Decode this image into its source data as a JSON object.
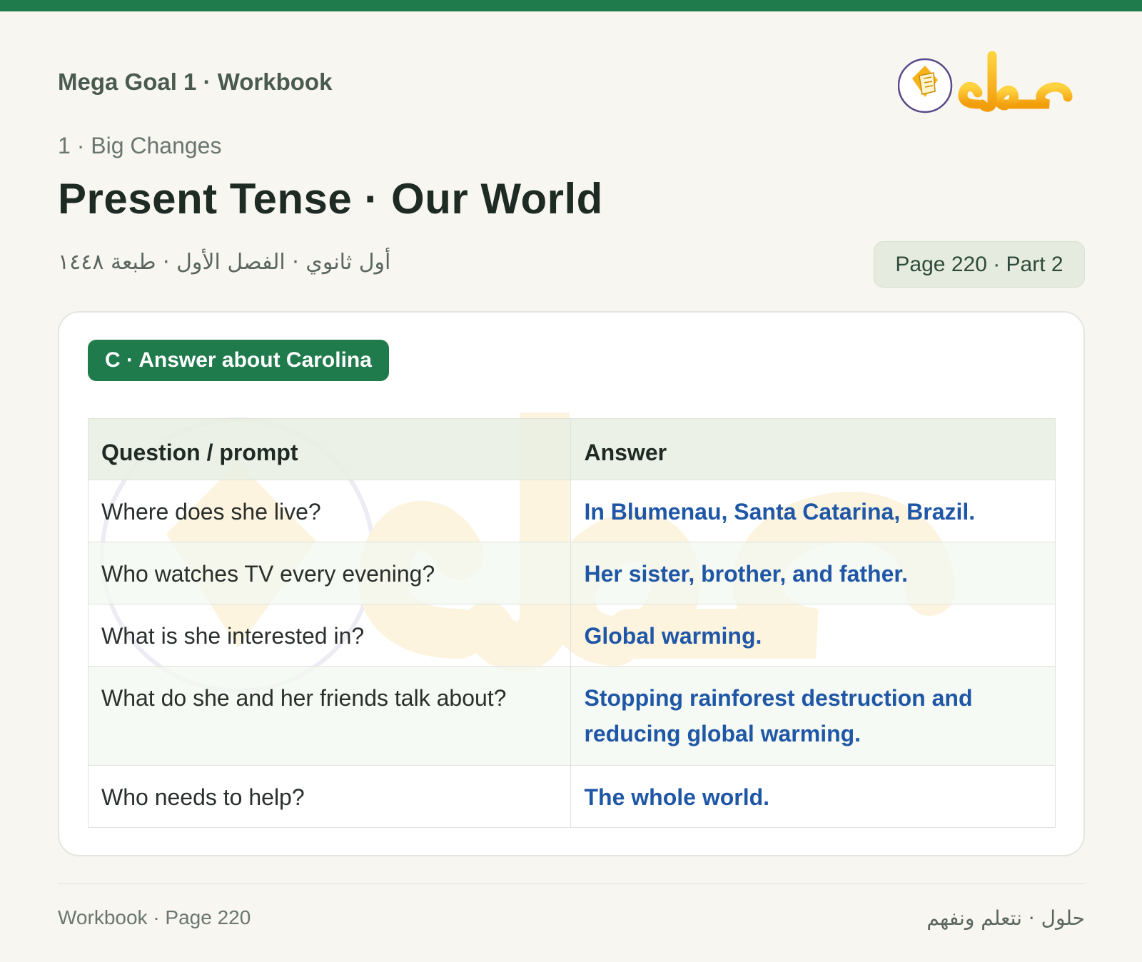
{
  "header": {
    "subtitle": "Mega Goal 1 · Workbook",
    "logo_text": "حلول",
    "unit": "1 · Big Changes",
    "title": "Present Tense · Our World",
    "arabic_meta": "أول ثانوي · الفصل الأول · طبعة ١٤٤٨",
    "page_badge": "Page 220 · Part 2"
  },
  "section": {
    "label": "C · Answer about Carolina"
  },
  "table": {
    "headers": [
      "Question / prompt",
      "Answer"
    ],
    "rows": [
      {
        "question": "Where does she live?",
        "answer": "In Blumenau, Santa Catarina, Brazil."
      },
      {
        "question": "Who watches TV every evening?",
        "answer": "Her sister, brother, and father."
      },
      {
        "question": "What is she interested in?",
        "answer": "Global warming."
      },
      {
        "question": "What do she and her friends talk about?",
        "answer": "Stopping rainforest destruction and reducing global warming."
      },
      {
        "question": "Who needs to help?",
        "answer": "The whole world."
      }
    ]
  },
  "footer": {
    "left": "Workbook · Page 220",
    "right": "حلول · نتعلم ونفهم"
  },
  "colors": {
    "brand_green": "#1f7a4c",
    "answer_blue": "#1f57a6",
    "logo_yellow": "#f5b316"
  }
}
